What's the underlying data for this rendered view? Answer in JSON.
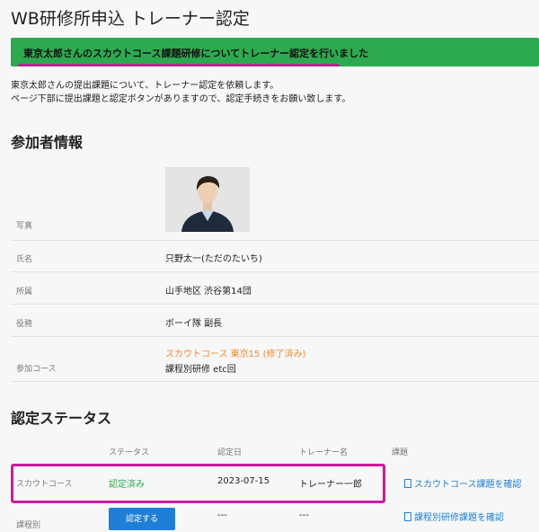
{
  "page": {
    "title": "WB研修所申込 トレーナー認定"
  },
  "alert": {
    "message": "東京太郎さんのスカウトコース課題研修についてトレーナー認定を行いました"
  },
  "intro": {
    "line1": "東京太郎さんの提出課題について、トレーナー認定を依頼します。",
    "line2": "ページ下部に提出課題と認定ボタンがありますので、認定手続きをお願い致します。"
  },
  "participant": {
    "heading": "参加者情報",
    "photo_label": "写真",
    "name_label": "氏名",
    "name_value": "只野太一(ただのたいち)",
    "affiliation_label": "所属",
    "affiliation_value": "山手地区 渋谷第14団",
    "role_label": "役務",
    "role_value": "ボーイ隊 副長",
    "course_label": "参加コース",
    "course_value_1": "スカウトコース 東京15 (修了済み)",
    "course_value_2": "課程別研修 etc回"
  },
  "status": {
    "heading": "認定ステータス",
    "columns": [
      "ステータス",
      "認定日",
      "トレーナー名",
      "課題"
    ],
    "rows": [
      {
        "course": "スカウトコース",
        "status": "認定済み",
        "date": "2023-07-15",
        "trainer": "トレーナー一郎",
        "link": "スカウトコース課題を確認"
      },
      {
        "course": "課程別",
        "button": "認定する",
        "date": "---",
        "trainer": "---",
        "link": "課程別研修課題を確認"
      }
    ]
  },
  "colors": {
    "alert_green": "#2daa4f",
    "highlight_magenta": "#d0199f",
    "link_blue": "#1f7fd6",
    "course_orange": "#f0892b"
  }
}
